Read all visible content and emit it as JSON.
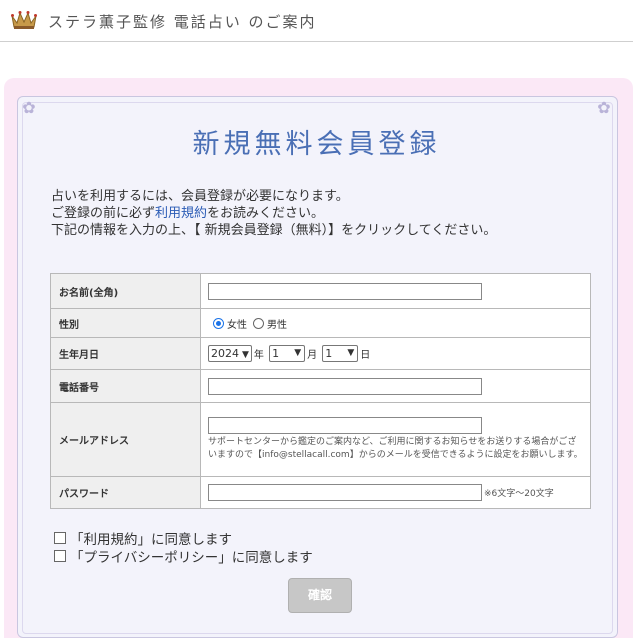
{
  "header": {
    "site_title": "ステラ薫子監修 電話占い のご案内"
  },
  "page": {
    "heading": "新規無料会員登録",
    "intro_line1": "占いを利用するには、会員登録が必要になります。",
    "intro_line2_pre": "ご登録の前に必ず",
    "intro_line2_link": "利用規約",
    "intro_line2_post": "をお読みください。",
    "intro_line3": "下記の情報を入力の上、【 新規会員登録（無料）】をクリックしてください。"
  },
  "form": {
    "name_label": "お名前(全角)",
    "name_value": "",
    "gender_label": "性別",
    "gender_female": "女性",
    "gender_male": "男性",
    "birth_label": "生年月日",
    "birth_year": "2024",
    "birth_year_unit": "年",
    "birth_month": "1",
    "birth_month_unit": "月",
    "birth_day": "1",
    "birth_day_unit": "日",
    "phone_label": "電話番号",
    "phone_value": "",
    "email_label": "メールアドレス",
    "email_value": "",
    "email_note": "サポートセンターから鑑定のご案内など、ご利用に関するお知らせをお送りする場合がございますので【info@stellacall.com】からのメールを受信できるように設定をお願いします。",
    "password_label": "パスワード",
    "password_value": "",
    "password_note": "※6文字～20文字"
  },
  "agreements": {
    "terms": "「利用規約」に同意します",
    "privacy": "「プライバシーポリシー」に同意します"
  },
  "buttons": {
    "confirm": "確認"
  },
  "colors": {
    "heading": "#4a6fb5",
    "link": "#2a5bb5",
    "pink_frame": "#fbe8f6",
    "panel": "#f3f3fb",
    "radio_checked": "#1a73e8"
  },
  "icons": {
    "logo": "crown-icon"
  }
}
